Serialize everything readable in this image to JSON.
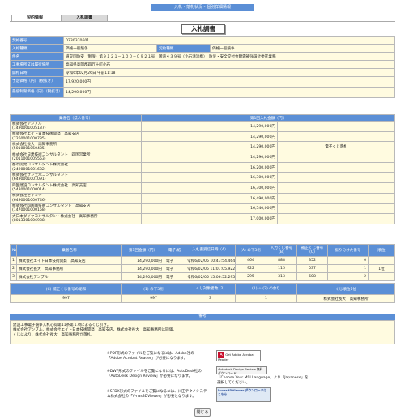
{
  "header": {
    "banner": "入札・落札状況 - 個別詳細情報"
  },
  "tabs": [
    {
      "label": "契約情報"
    },
    {
      "label": "入札調書"
    }
  ],
  "page_title": "入札調書",
  "info": [
    {
      "label": "契約番号",
      "value": "0230370601"
    },
    {
      "label": "入札種類",
      "value": "価格一般競争",
      "label2": "契約種類",
      "value2": "価格一般競争"
    },
    {
      "label": "件名",
      "value": "道交国防安（制限）第９１２１－１００－０９２１号　国道４３９号（小石清流橋）　防災・安全交付金耐震補強設計委託業務"
    },
    {
      "label": "工事場所又は履行場所",
      "value": "高知県高岡郡四万十町小石"
    },
    {
      "label": "開札日時",
      "value": "令和6年02月26日 午前11:18"
    },
    {
      "label": "予定価格（円）（税抜き）",
      "value": "17,920,000円"
    },
    {
      "label": "最低制限価格（円）（税抜き）",
      "value": "14,290,000円"
    }
  ],
  "bids": {
    "header_name": "業者名（法人番号）",
    "header_amount": "第1回入札金額（円）",
    "rows": [
      {
        "name": "株式会社アンブル",
        "corp": "(1490001005137)",
        "amount": "14,290,000円",
        "note": ""
      },
      {
        "name": "株式会社エイト日本技術開発　高知支店",
        "corp": "(7260001000735)",
        "amount": "14,290,000円",
        "note": ""
      },
      {
        "name": "株式会社長大　高知事務所",
        "corp": "(5010001050435)",
        "amount": "14,290,000円",
        "note": "電子くじ落札"
      },
      {
        "name": "株式会社日建技術コンサルタント　四国営業所",
        "corp": "(2011001005553)",
        "amount": "14,290,000円",
        "note": ""
      },
      {
        "name": "都市開発コンサルタント株式会社",
        "corp": "(2490001001632)",
        "amount": "16,200,000円",
        "note": ""
      },
      {
        "name": "株式会社サン土木コンサルタント",
        "corp": "(6490001001091)",
        "amount": "16,300,000円",
        "note": ""
      },
      {
        "name": "四国建設コンサルタント株式会社　高知支店",
        "corp": "(5480001000014)",
        "amount": "16,300,000円",
        "note": ""
      },
      {
        "name": "株式会社セイミツ",
        "corp": "(6490001000746)",
        "amount": "16,490,000円",
        "note": ""
      },
      {
        "name": "株式会社四国賞技術コンサルタント　高知支店",
        "corp": "(1470001000158)",
        "amount": "16,540,000円",
        "note": ""
      },
      {
        "name": "大日本ダイヤコンサルタント株式会社　高知事務所",
        "corp": "(8013301006938)",
        "amount": "17,000,000円",
        "note": ""
      }
    ]
  },
  "lottery": {
    "headers": [
      "No",
      "業者名称",
      "第1回金額（円）",
      "電子/紙",
      "入札書受信日時（A）",
      "(A) の下3桁",
      "入力くじ番号 (B)",
      "補正くじ番号 (C)",
      "振り分けた番号",
      "順位"
    ],
    "rows": [
      {
        "no": "1",
        "name": "株式会社エイト日本技術開発　高知支店",
        "amount": "14,290,000円",
        "type": "電子",
        "time": "令和6/02/05 10:43:54.464",
        "a3": "464",
        "b": "888",
        "c": "352",
        "assigned": "0",
        "rank": ""
      },
      {
        "no": "2",
        "name": "株式会社長大　高知事務所",
        "amount": "14,290,000円",
        "type": "電子",
        "time": "令和6/02/05 11:07:05.922",
        "a3": "922",
        "b": "115",
        "c": "037",
        "assigned": "1",
        "rank": "1位"
      },
      {
        "no": "3",
        "name": "株式会社アンブル",
        "amount": "14,290,000円",
        "type": "電子",
        "time": "令和6/02/05 15:06:52.295",
        "a3": "295",
        "b": "313",
        "c": "608",
        "assigned": "2",
        "rank": ""
      }
    ],
    "summary_headers": [
      "(C) 補正くじ番号の総和",
      "(1) の下3桁",
      "くじ対象者数 (2)",
      "(1) ÷ (2) の余り",
      "くじ順位1位"
    ],
    "summary_values": [
      "997",
      "997",
      "3",
      "1",
      "株式会社長大　高知事務所"
    ]
  },
  "notes": {
    "header": "備考",
    "lines": [
      "建設工事電子競争入札心得第11条第１項によるくじ引き。",
      "株式会社アンブル、株式会社エイト日本技術開発　高知支店、株式会社長大　高知事務所は同価。",
      "くじにより、株式会社長大　高知事務所が落札。"
    ]
  },
  "plugins": [
    {
      "text": "※PDF形式のファイルをご覧になるには、Adobe社の「Adobe Acrobat Reader」が必要になります。",
      "badge": "Get Adobe Acrobat Reader"
    },
    {
      "text": "※DWF形式のファイルをご覧になるには、AutoDesk社の「AutoDesk Design Review」が必要になります。",
      "badge": "Autodesk Design Review 無料ダウンロード",
      "extra": "「Choose Your MSI Language」より「Japanese」を選択してください。"
    },
    {
      "text": "※SFDX形式のファイルをご覧になるには、川田テクノシステム株式会社の「V-nas3DViewer」が必要となります。",
      "badge": "V-nas3DViewer ダウンロードはこちら"
    }
  ],
  "close_label": "閉じる",
  "colors": {
    "header_blue": "#5b8fd6",
    "cell_yellow": "#fffbe0"
  }
}
